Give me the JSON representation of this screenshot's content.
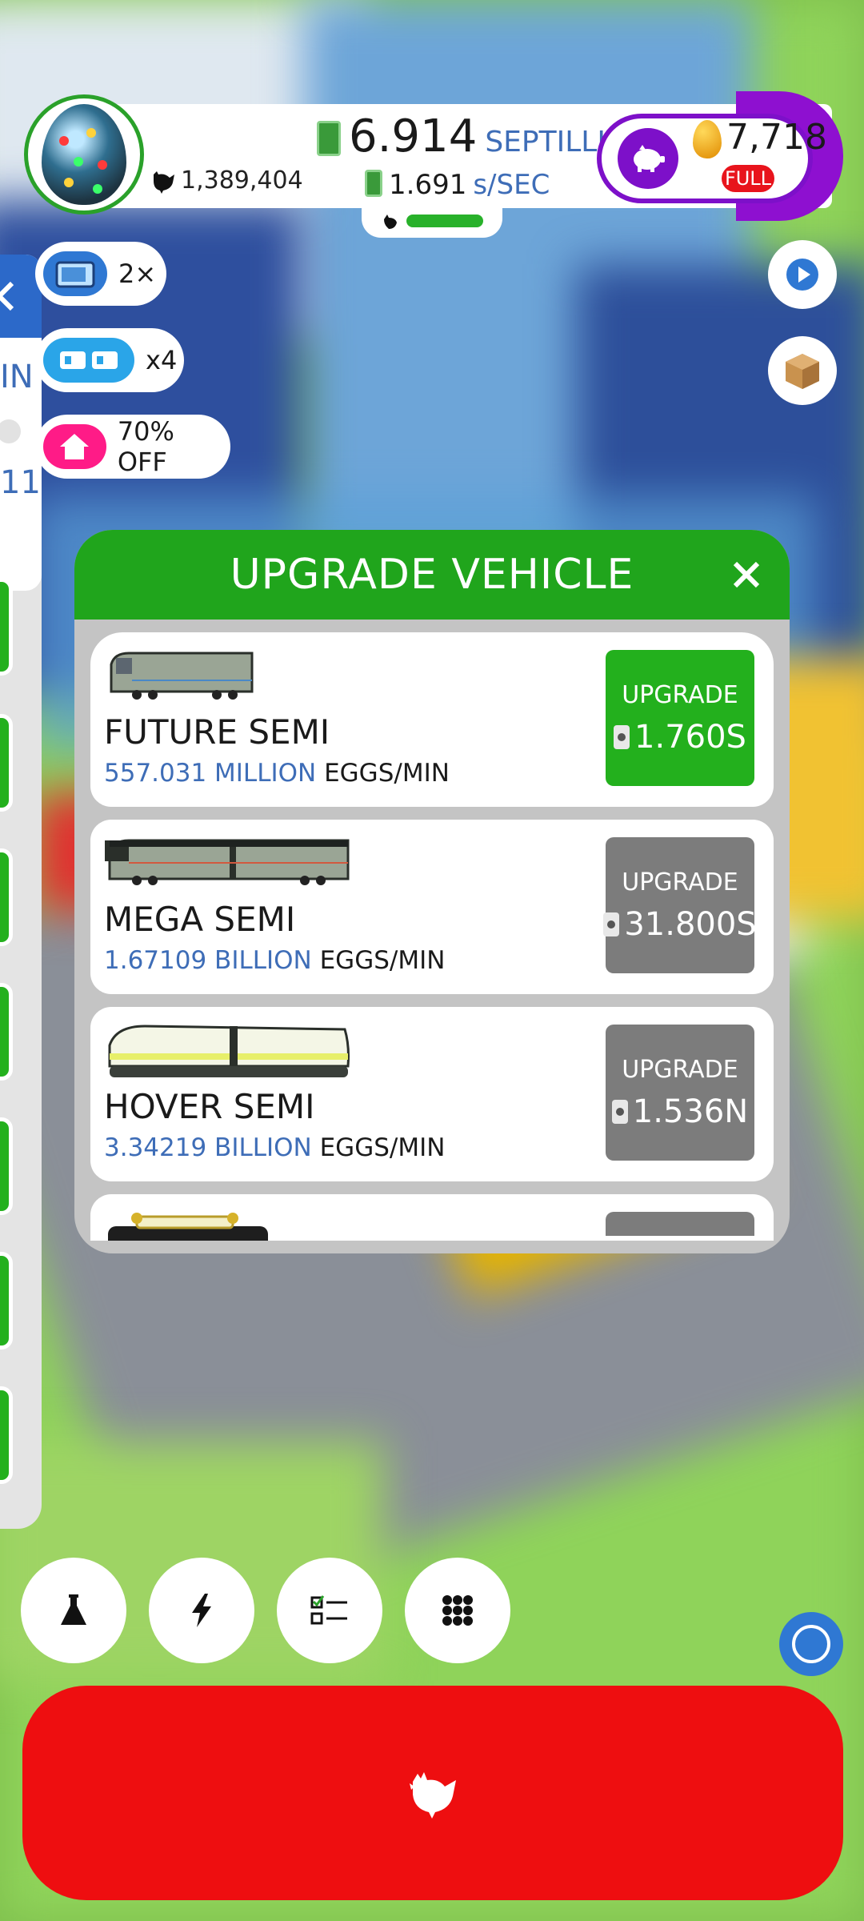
{
  "hud": {
    "chicken_count": "1,389,404",
    "money_value": "6.914",
    "money_unit": "SEPTILLION",
    "rate_value": "1.691",
    "rate_unit": "s/SEC",
    "golden_eggs": "7,718",
    "golden_status": "FULL"
  },
  "boosts": [
    {
      "icon": "tv-icon",
      "label": "2×"
    },
    {
      "icon": "boost-icon",
      "label": "x4"
    },
    {
      "icon": "house-icon",
      "label": "70% OFF"
    }
  ],
  "side_panel": {
    "fragment_top": "IN",
    "fragment_bottom": "11"
  },
  "modal": {
    "title": "UPGRADE VEHICLE",
    "upgrade_label": "UPGRADE",
    "rate_suffix": "EGGS/MIN",
    "vehicles": [
      {
        "name": "FUTURE SEMI",
        "rate": "557.031 MILLION",
        "price": "1.760S",
        "affordable": true
      },
      {
        "name": "MEGA SEMI",
        "rate": "1.67109 BILLION",
        "price": "31.800S",
        "affordable": false
      },
      {
        "name": "HOVER SEMI",
        "rate": "3.34219 BILLION",
        "price": "1.536N",
        "affordable": false
      }
    ]
  },
  "colors": {
    "primary_green": "#20a51c",
    "upgrade_disabled": "#7c7c7c",
    "accent_blue": "#3e6db7",
    "golden_purple": "#7d10c9",
    "chicken_button": "#ee0e10"
  },
  "bottom_bar": [
    {
      "icon": "flask-icon"
    },
    {
      "icon": "lightning-icon"
    },
    {
      "icon": "checklist-icon"
    },
    {
      "icon": "grid-icon"
    }
  ]
}
